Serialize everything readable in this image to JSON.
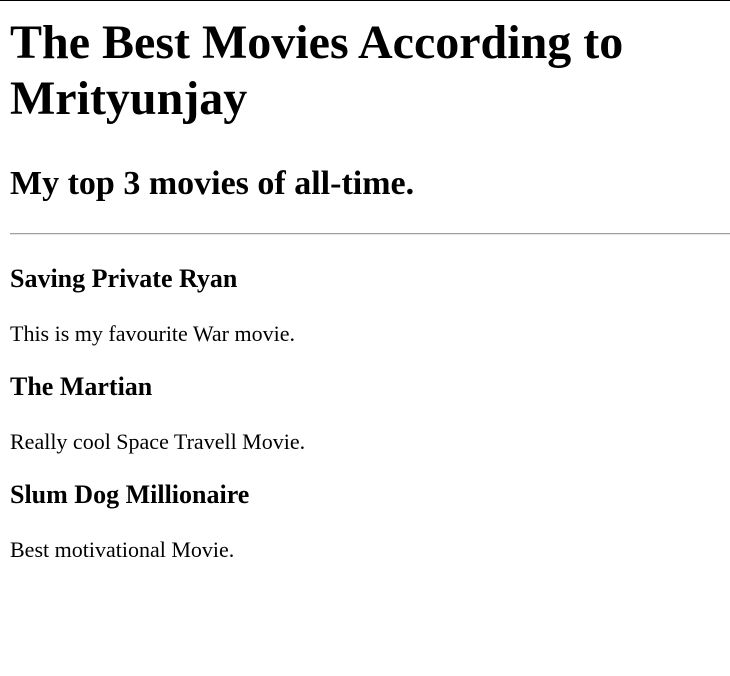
{
  "page": {
    "title": "The Best Movies According to Mrityunjay",
    "subtitle": "My top 3 movies of all-time."
  },
  "movies": [
    {
      "title": "Saving Private Ryan",
      "description": "This is my favourite War movie."
    },
    {
      "title": "The Martian",
      "description": "Really cool Space Travell Movie."
    },
    {
      "title": "Slum Dog Millionaire",
      "description": "Best motivational Movie."
    }
  ]
}
